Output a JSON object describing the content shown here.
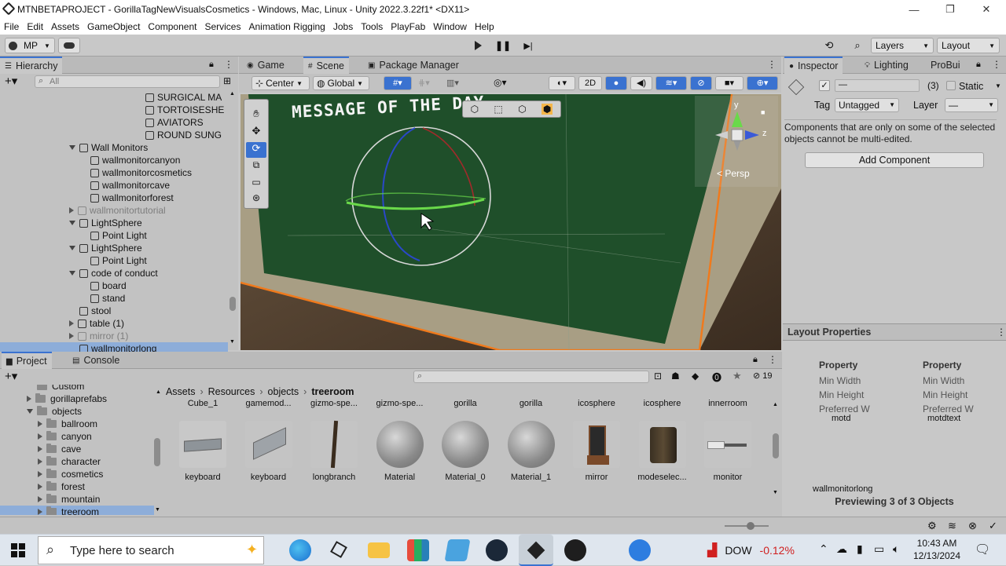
{
  "window": {
    "title": "MTNBETAPROJECT - GorillaTagNewVisualsCosmetics - Windows, Mac, Linux - Unity 2022.3.22f1* <DX11>"
  },
  "menu": [
    "File",
    "Edit",
    "Assets",
    "GameObject",
    "Component",
    "Services",
    "Animation Rigging",
    "Jobs",
    "Tools",
    "PlayFab",
    "Window",
    "Help"
  ],
  "toolbar": {
    "account": "MP",
    "layers": "Layers",
    "layout": "Layout"
  },
  "hierarchy": {
    "tab": "Hierarchy",
    "search_placeholder": "All",
    "rows": [
      {
        "label": "SURGICAL MA",
        "depth": 3,
        "arrow": "",
        "dim": false,
        "sel": false
      },
      {
        "label": "TORTOISESHE",
        "depth": 3,
        "arrow": "",
        "dim": false,
        "sel": false
      },
      {
        "label": "AVIATORS",
        "depth": 3,
        "arrow": "",
        "dim": false,
        "sel": false
      },
      {
        "label": "ROUND SUNG",
        "depth": 3,
        "arrow": "",
        "dim": false,
        "sel": false
      },
      {
        "label": "Wall Monitors",
        "depth": 1,
        "arrow": "down",
        "dim": false,
        "sel": false
      },
      {
        "label": "wallmonitorcanyon",
        "depth": 2,
        "arrow": "",
        "dim": false,
        "sel": false
      },
      {
        "label": "wallmonitorcosmetics",
        "depth": 2,
        "arrow": "",
        "dim": false,
        "sel": false
      },
      {
        "label": "wallmonitorcave",
        "depth": 2,
        "arrow": "",
        "dim": false,
        "sel": false
      },
      {
        "label": "wallmonitorforest",
        "depth": 2,
        "arrow": "",
        "dim": false,
        "sel": false
      },
      {
        "label": "wallmonitortutorial",
        "depth": 1,
        "arrow": "right",
        "dim": true,
        "sel": false
      },
      {
        "label": "LightSphere",
        "depth": 1,
        "arrow": "down",
        "dim": false,
        "sel": false
      },
      {
        "label": "Point Light",
        "depth": 2,
        "arrow": "",
        "dim": false,
        "sel": false
      },
      {
        "label": "LightSphere",
        "depth": 1,
        "arrow": "down",
        "dim": false,
        "sel": false
      },
      {
        "label": "Point Light",
        "depth": 2,
        "arrow": "",
        "dim": false,
        "sel": false
      },
      {
        "label": "code of conduct",
        "depth": 1,
        "arrow": "down",
        "dim": false,
        "sel": false
      },
      {
        "label": "board",
        "depth": 2,
        "arrow": "",
        "dim": false,
        "sel": false
      },
      {
        "label": "stand",
        "depth": 2,
        "arrow": "",
        "dim": false,
        "sel": false
      },
      {
        "label": "stool",
        "depth": 1,
        "arrow": "",
        "dim": false,
        "sel": false
      },
      {
        "label": "table (1)",
        "depth": 1,
        "arrow": "right",
        "dim": false,
        "sel": false
      },
      {
        "label": "mirror (1)",
        "depth": 1,
        "arrow": "right",
        "dim": true,
        "sel": false
      },
      {
        "label": "wallmonitorlong",
        "depth": 1,
        "arrow": "",
        "dim": false,
        "sel": true
      }
    ]
  },
  "scene_tabs": {
    "game": "Game",
    "scene": "Scene",
    "package": "Package Manager"
  },
  "scene_toolbar": {
    "pivot": "Center",
    "space": "Global",
    "mode2d": "2D"
  },
  "scene": {
    "message_text": "MESSAGE OF THE DAY",
    "persp": "Persp",
    "gizmo_y": "y",
    "gizmo_z": "z"
  },
  "inspector": {
    "tab_inspector": "Inspector",
    "tab_lighting": "Lighting",
    "tab_probuilder": "ProBui",
    "name_value": "—",
    "count": "(3)",
    "static_label": "Static",
    "tag_label": "Tag",
    "tag_value": "Untagged",
    "layer_label": "Layer",
    "layer_value": "—",
    "multi_edit_note": "Components that are only on some of the selected objects cannot be multi-edited.",
    "add_component": "Add Component",
    "layout_props_title": "Layout Properties",
    "props_col1": {
      "header": "Property",
      "items": [
        "Min Width",
        "Min Height",
        "Preferred W"
      ],
      "caption": "motd"
    },
    "props_col2": {
      "header": "Property",
      "items": [
        "Min Width",
        "Min Height",
        "Preferred W"
      ],
      "caption": "motdtext"
    },
    "preview_name": "wallmonitorlong",
    "preview_label": "Previewing 3 of 3 Objects"
  },
  "project": {
    "tab_project": "Project",
    "tab_console": "Console",
    "hidden_count": "19",
    "tree": [
      {
        "label": "Custom",
        "depth": 1,
        "arrow": ""
      },
      {
        "label": "gorillaprefabs",
        "depth": 1,
        "arrow": "right"
      },
      {
        "label": "objects",
        "depth": 1,
        "arrow": "down"
      },
      {
        "label": "ballroom",
        "depth": 2,
        "arrow": "right"
      },
      {
        "label": "canyon",
        "depth": 2,
        "arrow": "right"
      },
      {
        "label": "cave",
        "depth": 2,
        "arrow": "right"
      },
      {
        "label": "character",
        "depth": 2,
        "arrow": "right"
      },
      {
        "label": "cosmetics",
        "depth": 2,
        "arrow": "right"
      },
      {
        "label": "forest",
        "depth": 2,
        "arrow": "right"
      },
      {
        "label": "mountain",
        "depth": 2,
        "arrow": "right"
      },
      {
        "label": "treeroom",
        "depth": 2,
        "arrow": "right"
      }
    ],
    "breadcrumb": [
      "Assets",
      "Resources",
      "objects",
      "treeroom"
    ],
    "top_row": [
      "Cube_1",
      "gamemod...",
      "gizmo-spe...",
      "gizmo-spe...",
      "gorilla",
      "gorilla",
      "icosphere",
      "icosphere",
      "innerroom"
    ],
    "assets": [
      {
        "label": "keyboard",
        "kind": "keyboard"
      },
      {
        "label": "keyboard",
        "kind": "keyboard2"
      },
      {
        "label": "longbranch",
        "kind": "branch"
      },
      {
        "label": "Material",
        "kind": "sphere"
      },
      {
        "label": "Material_0",
        "kind": "sphere"
      },
      {
        "label": "Material_1",
        "kind": "sphere"
      },
      {
        "label": "mirror",
        "kind": "mirror"
      },
      {
        "label": "modeselec...",
        "kind": "stump"
      },
      {
        "label": "monitor",
        "kind": "monitor"
      }
    ]
  },
  "taskbar": {
    "search_placeholder": "Type here to search",
    "stock_name": "DOW",
    "stock_change": "-0.12%",
    "time": "10:43 AM",
    "date": "12/13/2024"
  }
}
